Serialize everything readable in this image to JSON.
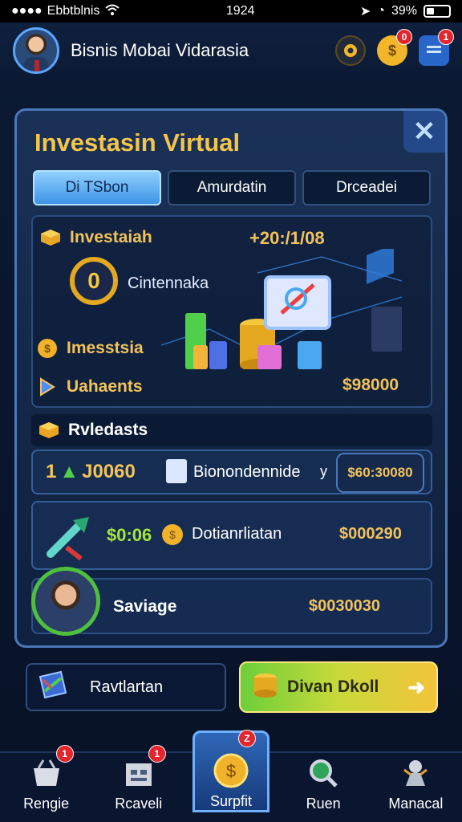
{
  "status_bar": {
    "carrier": "Ebbtblnis",
    "time": "1924",
    "battery": "39%"
  },
  "app": {
    "title": "Bisnis Mobai Vidarasia",
    "header_badges": [
      "0",
      "1"
    ]
  },
  "panel": {
    "title": "Investasin Virtual",
    "tabs": [
      "Di TSbon",
      "Amurdatin",
      "Drceadei"
    ],
    "active_tab_index": 0,
    "top_amount": "+20:/1/08",
    "investasi_label": "Investaiah",
    "ring_glyph": "0",
    "ring_text": "Cintennaka",
    "imesstia_label": "Imesstsia",
    "uahaents_label": "Uahaents",
    "uahaents_amount": "$98000",
    "list_header": "Rvledasts",
    "list_rows": [
      {
        "left": "1",
        "amount": "J0060",
        "name": "Bionondennide",
        "suffix": "y",
        "pill": "$60:30080"
      },
      {
        "amount": "$0:06",
        "name": "Dotianrliatan",
        "value": "$000290"
      }
    ],
    "savings_label": "Saviage",
    "savings_amount": "$0030030"
  },
  "bottom_actions": {
    "left_label": "Ravtlartan",
    "cta_label": "Divan Dkoll"
  },
  "bottom_nav": [
    {
      "label": "Rengie",
      "icon": "basket-icon",
      "badge": "1"
    },
    {
      "label": "Rcaveli",
      "icon": "building-icon",
      "badge": "1"
    },
    {
      "label": "Surpfit",
      "icon": "coin-icon",
      "badge": "Z"
    },
    {
      "label": "Ruen",
      "icon": "magnifier-icon",
      "badge": ""
    },
    {
      "label": "Manacal",
      "icon": "mascot-icon",
      "badge": ""
    }
  ],
  "colors": {
    "gold": "#f2c35a",
    "accent_blue": "#3d94e6",
    "cta_green": "#6ccf3a",
    "badge_red": "#e3262e"
  }
}
